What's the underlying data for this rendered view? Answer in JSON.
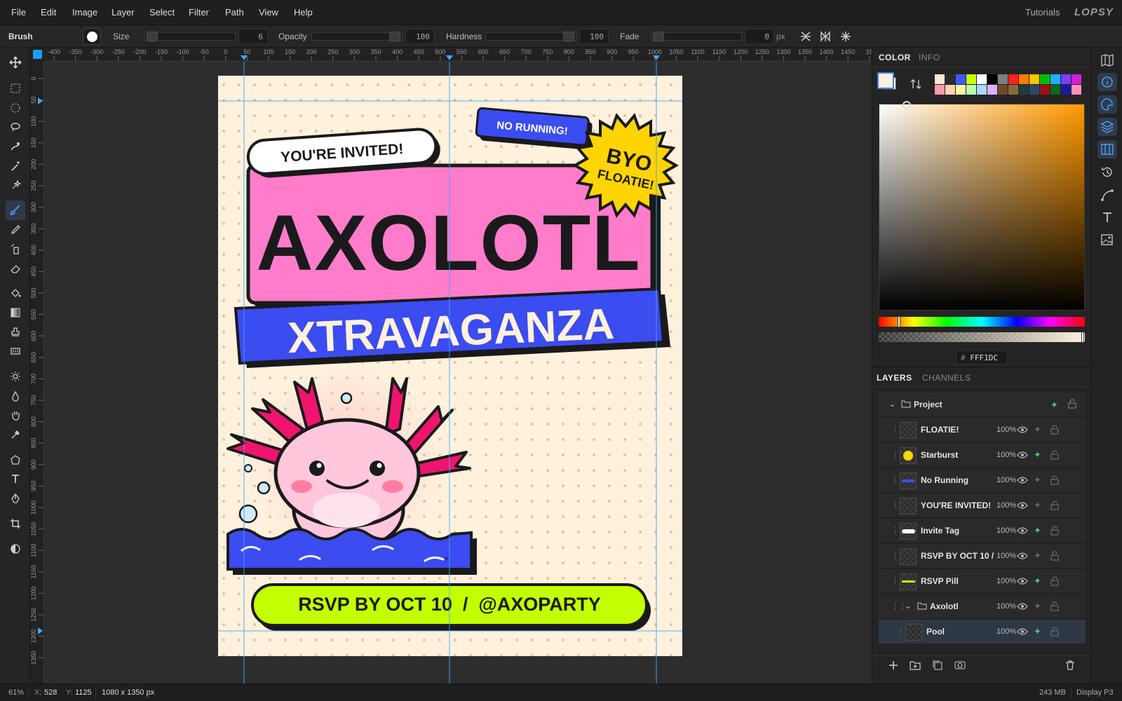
{
  "menu": {
    "items": [
      "File",
      "Edit",
      "Image",
      "Layer",
      "Select",
      "Filter",
      "Path",
      "View",
      "Help"
    ],
    "tutorials": "Tutorials",
    "logo": "LOPSY"
  },
  "options": {
    "tool": "Brush",
    "size_label": "Size",
    "size_value": "6",
    "opacity_label": "Opacity",
    "opacity_value": "100",
    "hardness_label": "Hardness",
    "hardness_value": "100",
    "fade_label": "Fade",
    "fade_value": "0",
    "fade_unit": "px"
  },
  "rulers": {
    "top_ticks": [
      "-400",
      "-350",
      "-300",
      "-250",
      "-200",
      "-150",
      "-100",
      "-50",
      "0",
      "50",
      "100",
      "150",
      "200",
      "250",
      "300",
      "350",
      "400",
      "450",
      "500",
      "550",
      "600",
      "650",
      "700",
      "750",
      "800",
      "850",
      "900",
      "950",
      "1000",
      "1050",
      "1100",
      "1150",
      "1200",
      "1250",
      "1300",
      "1350",
      "1400",
      "1450",
      "15"
    ],
    "left_ticks": [
      "0",
      "50",
      "100",
      "150",
      "200",
      "250",
      "300",
      "350",
      "400",
      "450",
      "500",
      "550",
      "600",
      "650",
      "700",
      "750",
      "800",
      "850",
      "900",
      "950",
      "1000",
      "1050",
      "1100",
      "1150",
      "1200",
      "1250",
      "1300",
      "1350"
    ]
  },
  "poster": {
    "invite": "YOU'RE INVITED!",
    "no_running": "NO RUNNING!",
    "byo_line1": "BYO",
    "byo_line2": "FLOATIE!",
    "title": "AXOLOTL",
    "subtitle": "XTRAVAGANZA",
    "rsvp": "RSVP BY OCT 10  /  @AXOPARTY"
  },
  "color_panel": {
    "tabs": [
      "COLOR",
      "INFO"
    ],
    "hex_prefix": "#",
    "hex_value": "FFF1DC",
    "foreground": "#FFF1DC",
    "swatches_row1": [
      "#fde7cf",
      "#2b2b2b",
      "#3b5bff",
      "#c9ff00",
      "#ffffff",
      "#000000",
      "#808080",
      "#ff2020",
      "#ff7a00",
      "#ffc400",
      "#00c000",
      "#1bb0ff",
      "#7a3cff",
      "#d11fd1"
    ],
    "swatches_row2": [
      "#ff9aaa",
      "#ffd2b0",
      "#fff5a0",
      "#b8ffb0",
      "#aad8ff",
      "#d9b0ff",
      "#6b4a2a",
      "#8a6a3a",
      "#1f3b3b",
      "#2a4a6a",
      "#a01010",
      "#0a6a1a",
      "#1a1aa0",
      "#ff8fbf"
    ]
  },
  "layers_panel": {
    "tabs": [
      "LAYERS",
      "CHANNELS"
    ],
    "project": "Project",
    "layers": [
      {
        "name": "FLOATIE!",
        "opacity": "100%"
      },
      {
        "name": "Starburst",
        "opacity": "100%"
      },
      {
        "name": "No Running",
        "opacity": "100%"
      },
      {
        "name": "YOU'RE INVITED!",
        "opacity": "100%"
      },
      {
        "name": "Invite Tag",
        "opacity": "100%"
      },
      {
        "name": "RSVP BY OCT 10 /",
        "opacity": "100%"
      },
      {
        "name": "RSVP Pill",
        "opacity": "100%"
      },
      {
        "name": "Axolotl",
        "opacity": "100%"
      },
      {
        "name": "Pool",
        "opacity": "100%"
      }
    ]
  },
  "status": {
    "zoom": "61%",
    "x_label": "X:",
    "x_value": "528",
    "y_label": "Y:",
    "y_value": "1125",
    "doc_size": "1080 x 1350 px",
    "memory": "243 MB",
    "profile": "Display P3"
  },
  "colors": {
    "accent": "#3b82f6",
    "poster_bg": "#FFF1DC",
    "pink": "#ff7ccb",
    "blue": "#3b4cf0",
    "lime": "#c3ff00",
    "yellow": "#ffd400"
  }
}
